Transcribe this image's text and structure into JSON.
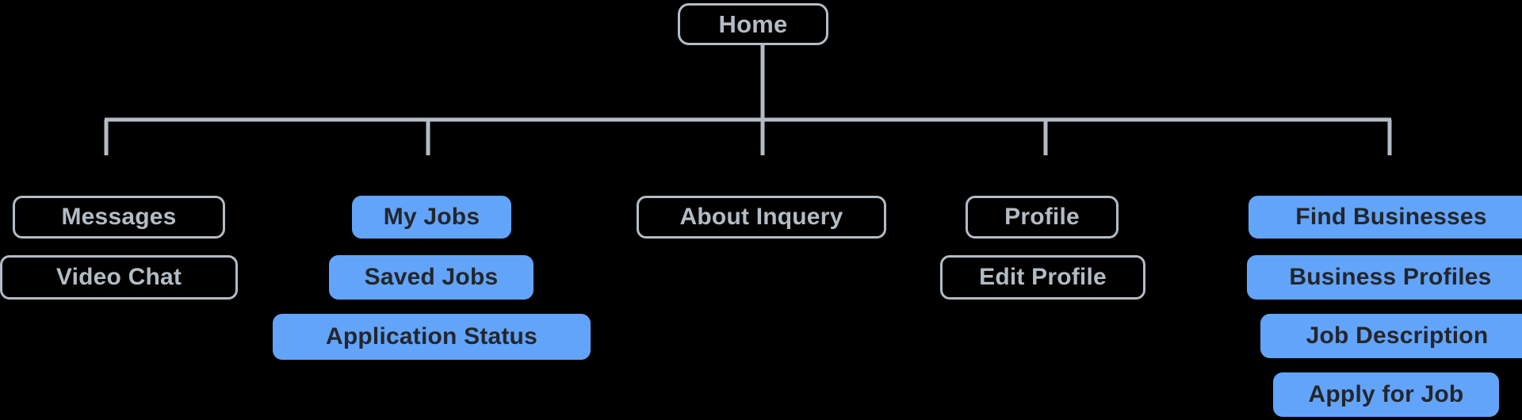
{
  "diagram": {
    "title": "Home",
    "background_color": "#000000",
    "styles": {
      "outline_border_color": "#b3bcc4",
      "outline_text_color": "#b3bcc4",
      "filled_background_color": "#63a4fb",
      "filled_text_color": "#23262b",
      "connector_color": "#b3bcc4"
    }
  },
  "root": {
    "label": "Home",
    "style": "outline"
  },
  "branches": [
    {
      "name": "messages-branch",
      "nodes": [
        {
          "label": "Messages",
          "style": "outline"
        },
        {
          "label": "Video Chat",
          "style": "outline"
        }
      ]
    },
    {
      "name": "jobs-branch",
      "nodes": [
        {
          "label": "My Jobs",
          "style": "filled"
        },
        {
          "label": "Saved Jobs",
          "style": "filled"
        },
        {
          "label": "Application Status",
          "style": "filled"
        }
      ]
    },
    {
      "name": "about-branch",
      "nodes": [
        {
          "label": "About Inquery",
          "style": "outline"
        }
      ]
    },
    {
      "name": "profile-branch",
      "nodes": [
        {
          "label": "Profile",
          "style": "outline"
        },
        {
          "label": "Edit Profile",
          "style": "outline"
        }
      ]
    },
    {
      "name": "business-branch",
      "nodes": [
        {
          "label": "Find Businesses",
          "style": "filled"
        },
        {
          "label": "Business Profiles",
          "style": "filled"
        },
        {
          "label": "Job Description",
          "style": "filled"
        },
        {
          "label": "Apply for Job",
          "style": "filled"
        }
      ]
    }
  ]
}
